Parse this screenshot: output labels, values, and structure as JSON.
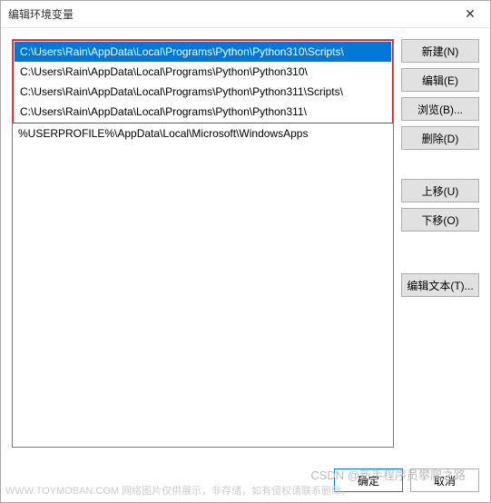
{
  "title": "编辑环境变量",
  "close_glyph": "✕",
  "list": {
    "highlighted": [
      "C:\\Users\\Rain\\AppData\\Local\\Programs\\Python\\Python310\\Scripts\\",
      "C:\\Users\\Rain\\AppData\\Local\\Programs\\Python\\Python310\\",
      "C:\\Users\\Rain\\AppData\\Local\\Programs\\Python\\Python311\\Scripts\\",
      "C:\\Users\\Rain\\AppData\\Local\\Programs\\Python\\Python311\\"
    ],
    "rest": [
      "%USERPROFILE%\\AppData\\Local\\Microsoft\\WindowsApps"
    ],
    "selected_index": 0
  },
  "buttons": {
    "new": "新建(N)",
    "edit": "编辑(E)",
    "browse": "浏览(B)...",
    "delete": "删除(D)",
    "up": "上移(U)",
    "down": "下移(O)",
    "edit_text": "编辑文本(T)...",
    "ok": "确定",
    "cancel": "取消"
  },
  "watermarks": {
    "csdn": "CSDN @新手程序员攀爬之路",
    "bottom": "WWW.TOYMOBAN.COM   网络图片仅供展示，非存储，如有侵权请联系删除。"
  }
}
